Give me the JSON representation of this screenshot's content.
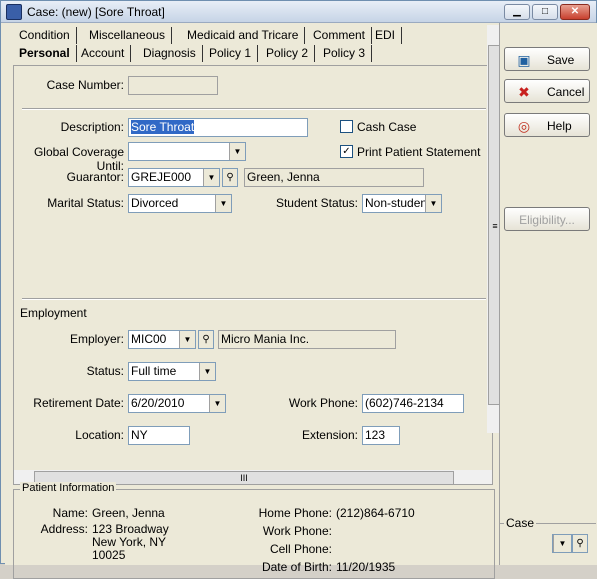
{
  "window": {
    "title": "Case: (new) [Sore Throat]",
    "min": "▁",
    "max": "□",
    "close": "✕"
  },
  "tabs": {
    "row1": [
      "Condition",
      "Miscellaneous",
      "Medicaid and Tricare",
      "Comment",
      "EDI"
    ],
    "row2": [
      "Personal",
      "Account",
      "Diagnosis",
      "Policy 1",
      "Policy 2",
      "Policy 3"
    ]
  },
  "case": {
    "number_label": "Case Number:",
    "number_value": ""
  },
  "form": {
    "description_label": "Description:",
    "description_value": "Sore Throat",
    "cash_case_label": "Cash Case",
    "cash_case_checked": false,
    "global_coverage_label": "Global Coverage Until:",
    "global_coverage_value": "",
    "print_statement_label": "Print Patient Statement",
    "print_statement_checked": true,
    "guarantor_label": "Guarantor:",
    "guarantor_code": "GREJE000",
    "guarantor_name": "Green, Jenna",
    "marital_label": "Marital Status:",
    "marital_value": "Divorced",
    "student_label": "Student Status:",
    "student_value": "Non-student"
  },
  "employment": {
    "section_label": "Employment",
    "employer_label": "Employer:",
    "employer_code": "MIC00",
    "employer_name": "Micro Mania Inc.",
    "status_label": "Status:",
    "status_value": "Full time",
    "retirement_label": "Retirement Date:",
    "retirement_value": "6/20/2010",
    "work_phone_label": "Work Phone:",
    "work_phone_value": "(602)746-2134",
    "location_label": "Location:",
    "location_value": "NY",
    "extension_label": "Extension:",
    "extension_value": "123"
  },
  "patient_info": {
    "legend": "Patient Information",
    "name_label": "Name:",
    "name_value": "Green, Jenna",
    "address_label": "Address:",
    "address_line1": "123 Broadway",
    "address_line2": "New York, NY",
    "address_line3": "10025",
    "home_phone_label": "Home Phone:",
    "home_phone_value": "(212)864-6710",
    "work_phone_label": "Work Phone:",
    "work_phone_value": "",
    "cell_phone_label": "Cell Phone:",
    "cell_phone_value": "",
    "dob_label": "Date of Birth:",
    "dob_value": "11/20/1935"
  },
  "buttons": {
    "save": "Save",
    "cancel": "Cancel",
    "help": "Help",
    "eligibility": "Eligibility...",
    "case_label": "Case"
  },
  "icons": {
    "arrow_down": "▼",
    "lookup": "⚲",
    "check": "✓",
    "grip": "≡",
    "hgrip": "III",
    "save_icon": "▣",
    "cancel_icon": "✖",
    "help_icon": "◎"
  }
}
